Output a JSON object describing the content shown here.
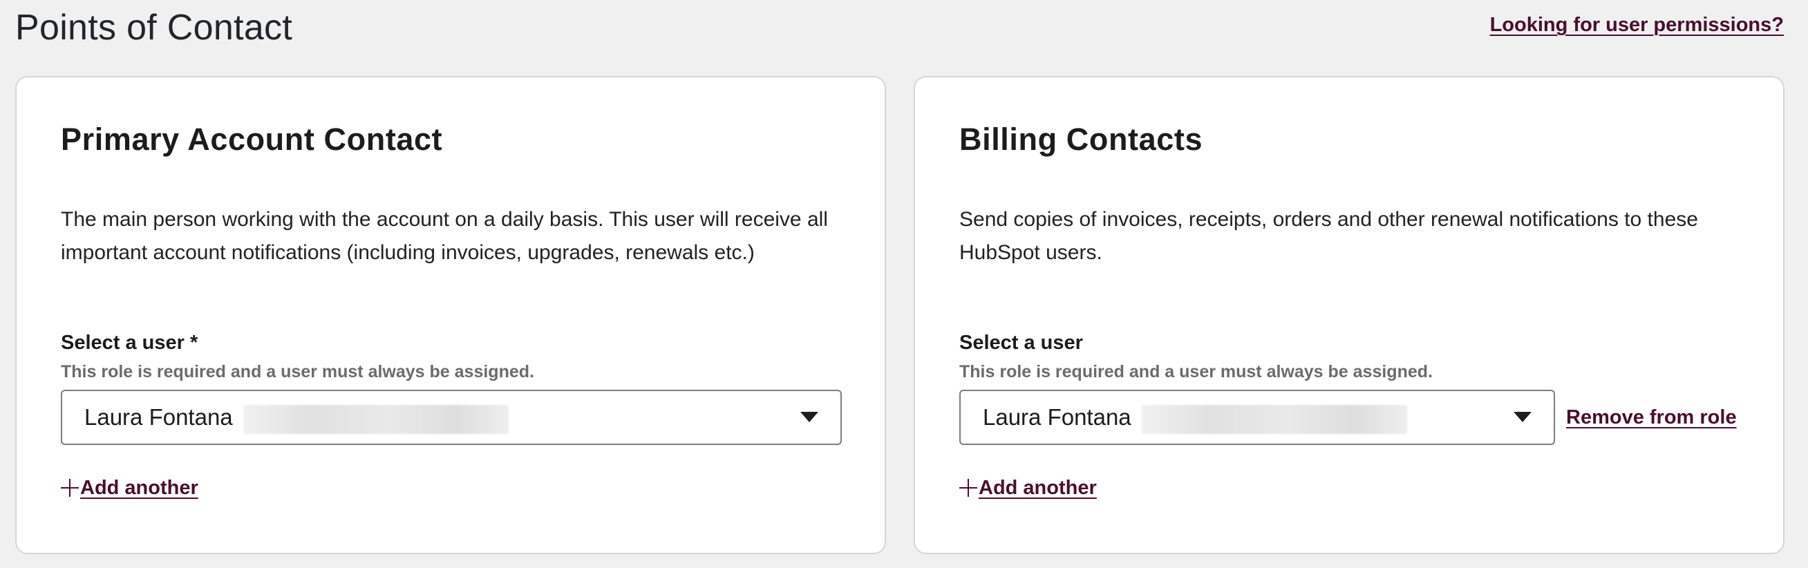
{
  "header": {
    "title": "Points of Contact",
    "permissions_link": "Looking for user permissions?"
  },
  "primary": {
    "title": "Primary Account Contact",
    "description": "The main person working with the account on a daily basis. This user will receive all important account notifications (including invoices, upgrades, renewals etc.)",
    "field_label": "Select a user *",
    "help_text": "This role is required and a user must always be assigned.",
    "selected_user": "Laura Fontana",
    "add_another": "Add another"
  },
  "billing": {
    "title": "Billing Contacts",
    "description": "Send copies of invoices, receipts, orders and other renewal notifications to these HubSpot users.",
    "field_label": "Select a user",
    "help_text": "This role is required and a user must always be assigned.",
    "selected_user": "Laura Fontana",
    "remove_link": "Remove from role",
    "add_another": "Add another"
  },
  "colors": {
    "link": "#4a0e2e",
    "background": "#f0f0f0",
    "card": "#ffffff"
  }
}
